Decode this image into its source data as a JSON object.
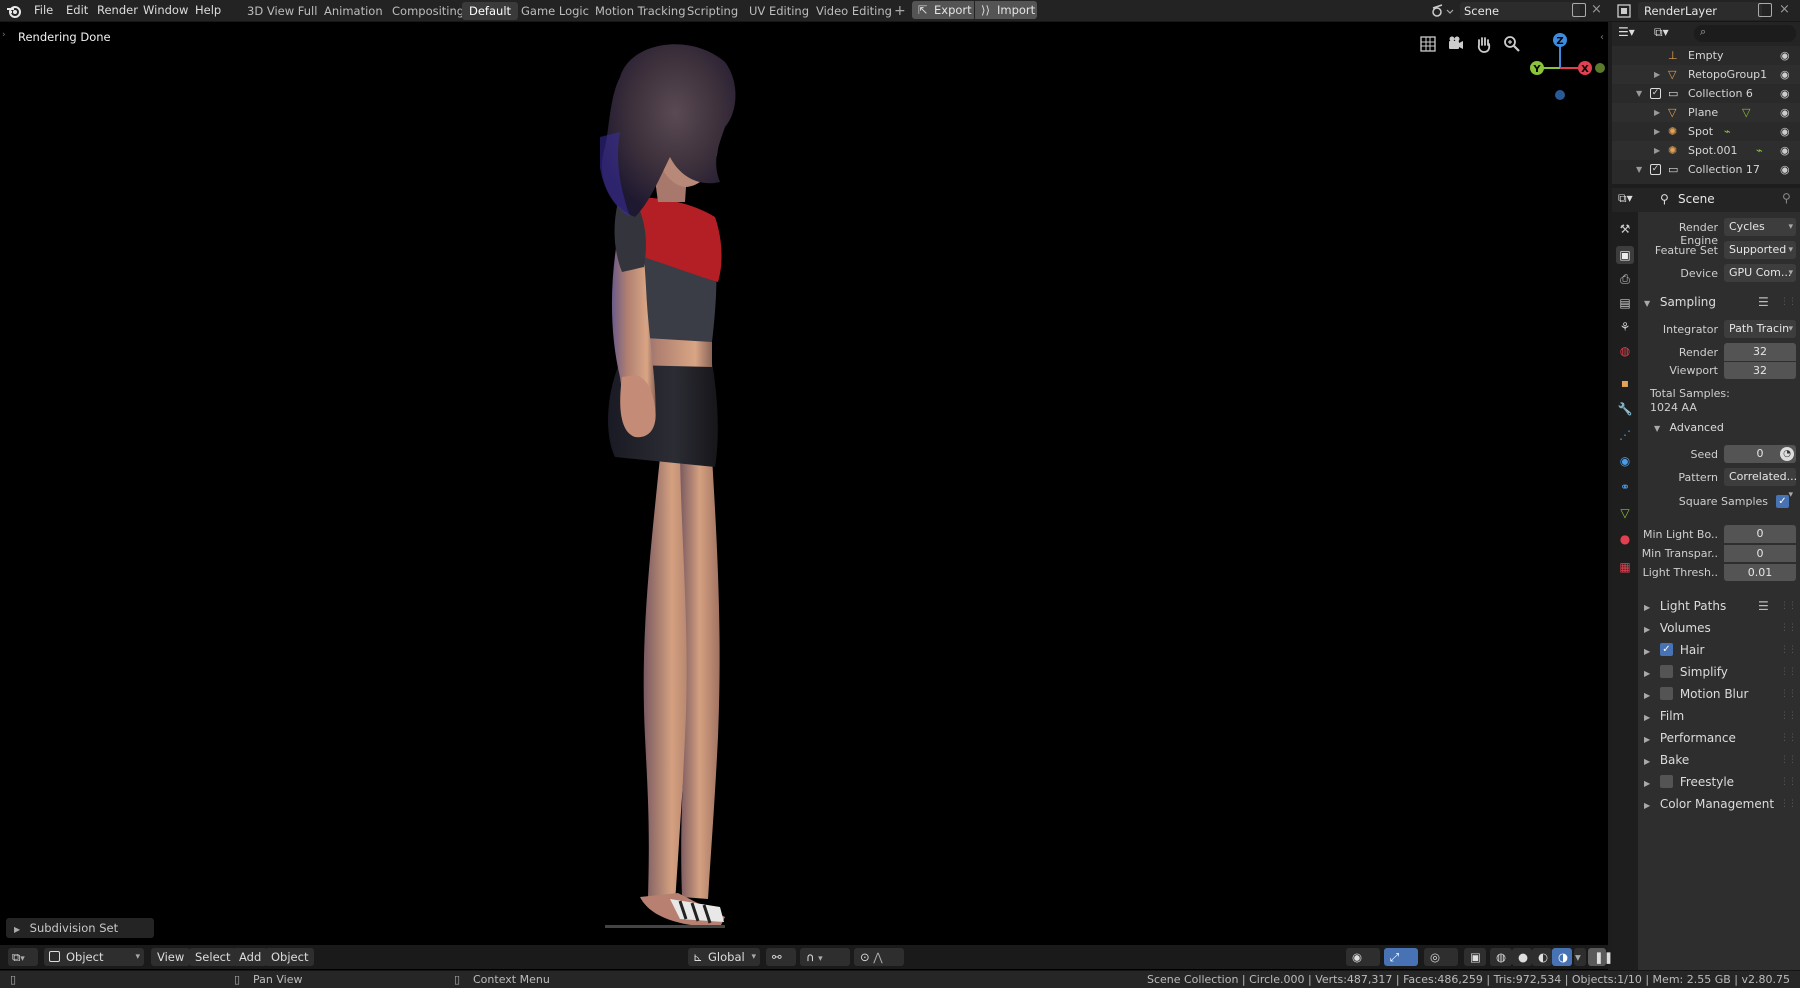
{
  "topbar": {
    "menus": [
      "File",
      "Edit",
      "Render",
      "Window",
      "Help"
    ],
    "workspaces": [
      "3D View Full",
      "Animation",
      "Compositing",
      "Default",
      "Game Logic",
      "Motion Tracking",
      "Scripting",
      "UV Editing",
      "Video Editing"
    ],
    "active_workspace": "Default",
    "export_label": "Export",
    "import_label": "Import",
    "scene_name": "Scene",
    "view_layer": "RenderLayer"
  },
  "viewport": {
    "status_text": "Rendering Done",
    "gizmo": {
      "z": "Z",
      "y": "Y",
      "x": "X"
    },
    "last_operator": "Subdivision Set"
  },
  "viewport_header": {
    "mode": "Object Mode",
    "menus": [
      "View",
      "Select",
      "Add",
      "Object"
    ],
    "transform_orientation": "Global"
  },
  "statusbar": {
    "pan_hint": "Pan View",
    "context_hint": "Context Menu",
    "stats": "Scene Collection | Circle.000 | Verts:487,317 | Faces:486,259 | Tris:972,534 | Objects:1/10 | Mem: 2.55 GB | v2.80.75"
  },
  "outliner": {
    "items": [
      {
        "name": "Empty",
        "type": "empty"
      },
      {
        "name": "RetopoGroup1",
        "type": "mesh"
      },
      {
        "name": "Collection 6",
        "type": "collection"
      },
      {
        "name": "Plane",
        "type": "mesh"
      },
      {
        "name": "Spot",
        "type": "light"
      },
      {
        "name": "Spot.001",
        "type": "light"
      },
      {
        "name": "Collection 17",
        "type": "collection"
      }
    ]
  },
  "properties": {
    "context_title": "Scene",
    "render_engine_label": "Render Engine",
    "render_engine": "Cycles",
    "feature_set_label": "Feature Set",
    "feature_set": "Supported",
    "device_label": "Device",
    "device": "GPU Com...",
    "sampling": {
      "title": "Sampling",
      "integrator_label": "Integrator",
      "integrator": "Path Tracin",
      "render_label": "Render",
      "render": "32",
      "viewport_label": "Viewport",
      "viewport": "32",
      "total_label": "Total Samples:",
      "total_value": "1024 AA",
      "advanced_title": "Advanced",
      "seed_label": "Seed",
      "seed": "0",
      "pattern_label": "Pattern",
      "pattern": "Correlated...",
      "square_label": "Square Samples",
      "square_checked": true,
      "min_light_label": "Min Light Bo..",
      "min_light": "0",
      "min_transp_label": "Min Transpar..",
      "min_transp": "0",
      "light_thresh_label": "Light Thresh..",
      "light_thresh": "0.01"
    },
    "panels": [
      {
        "name": "Light Paths",
        "checkbox": null,
        "presets": true
      },
      {
        "name": "Volumes",
        "checkbox": null,
        "presets": false
      },
      {
        "name": "Hair",
        "checkbox": true,
        "presets": false
      },
      {
        "name": "Simplify",
        "checkbox": false,
        "presets": false
      },
      {
        "name": "Motion Blur",
        "checkbox": false,
        "presets": false
      },
      {
        "name": "Film",
        "checkbox": null,
        "presets": false
      },
      {
        "name": "Performance",
        "checkbox": null,
        "presets": false
      },
      {
        "name": "Bake",
        "checkbox": null,
        "presets": false
      },
      {
        "name": "Freestyle",
        "checkbox": false,
        "presets": false
      },
      {
        "name": "Color Management",
        "checkbox": null,
        "presets": false
      }
    ]
  },
  "colors": {
    "accent": "#4772b3",
    "axis_x": "#e0404f",
    "axis_y": "#8bc43a",
    "axis_z": "#3c8de0",
    "shirt_red": "#b31f25"
  }
}
